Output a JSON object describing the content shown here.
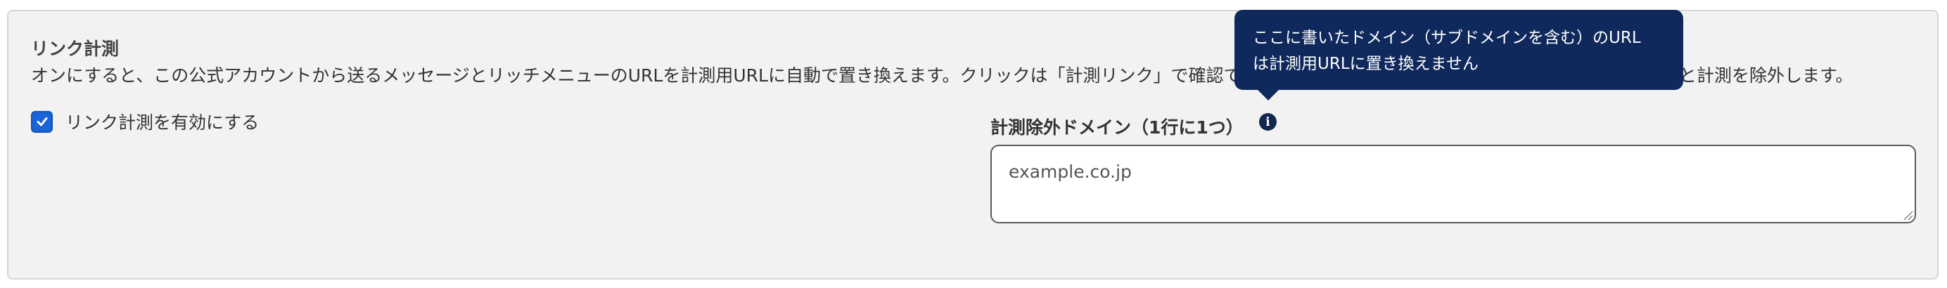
{
  "section": {
    "title": "リンク計測",
    "description": "オンにすると、この公式アカウントから送るメッセージとリッチメニューのURLを計測用URLに自動で置き換えます。クリックは「計測リンク」で確認できます。置き換えたくないドメインは右の欄に入力すると計測を除外します。"
  },
  "checkbox": {
    "label": "リンク計測を有効にする",
    "checked": true
  },
  "excluded_domains": {
    "label": "計測除外ドメイン（1行に1つ）",
    "placeholder": "example.co.jp",
    "value": ""
  },
  "tooltip": {
    "line1": "ここに書いたドメイン（サブドメインを含む）のURL",
    "line2": "は計測用URLに置き換えません"
  },
  "icons": {
    "info": "info-icon",
    "check": "check-icon",
    "resize": "resize-handle-icon"
  },
  "colors": {
    "accent": "#1a63d9",
    "tooltip_bg": "#10295c",
    "panel_bg": "#f2f2f2"
  }
}
